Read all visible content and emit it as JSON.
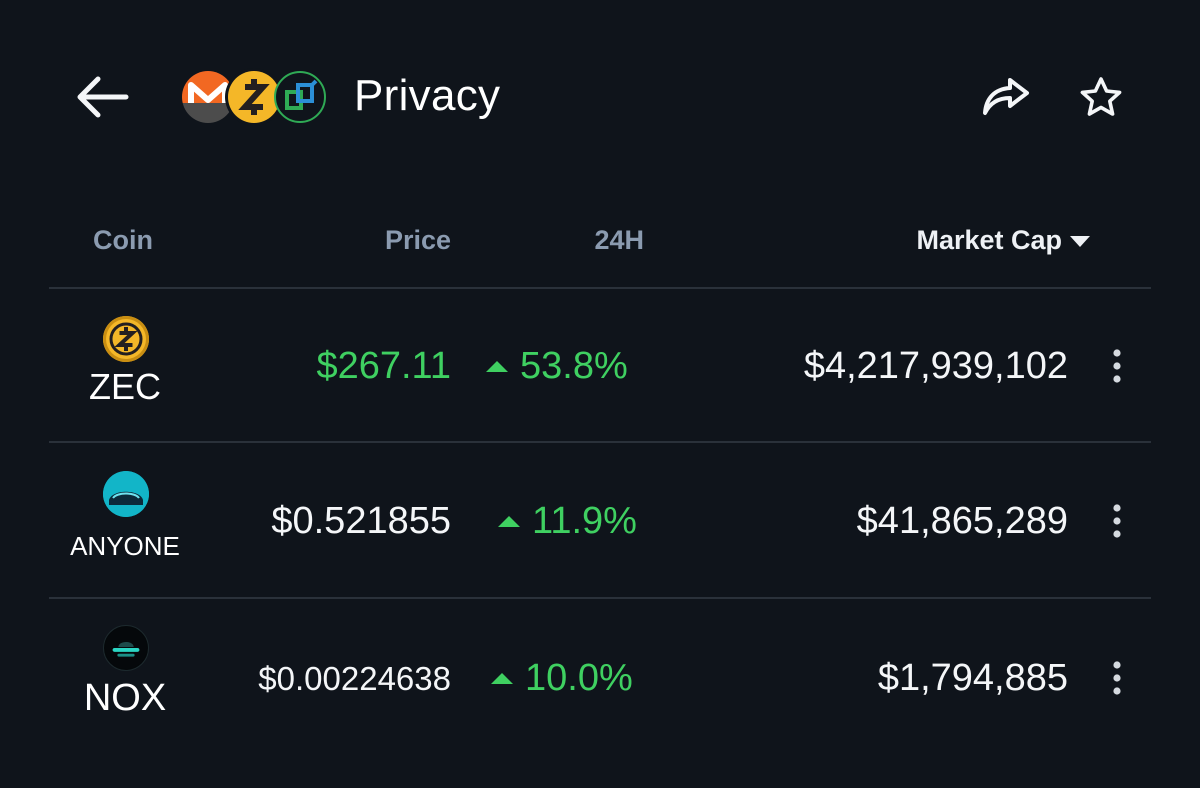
{
  "header": {
    "title": "Privacy",
    "back_icon": "arrow-left-icon",
    "share_icon": "share-icon",
    "favorite_icon": "star-icon",
    "category_logos": [
      "monero-logo",
      "zcash-logo",
      "category-coin-logo"
    ]
  },
  "table": {
    "columns": {
      "coin": "Coin",
      "price": "Price",
      "change": "24H",
      "market_cap": "Market Cap"
    },
    "sort": {
      "column": "market_cap",
      "direction": "descending"
    },
    "rows": [
      {
        "symbol": "ZEC",
        "price": "$267.11",
        "change": "53.8%",
        "direction": "up",
        "market_cap": "$4,217,939,102",
        "price_color": "#3fd061"
      },
      {
        "symbol": "ANYONE",
        "price": "$0.521855",
        "change": "11.9%",
        "direction": "up",
        "market_cap": "$41,865,289",
        "price_color": "#f4f6f8"
      },
      {
        "symbol": "NOX",
        "price": "$0.00224638",
        "change": "10.0%",
        "direction": "up",
        "market_cap": "$1,794,885",
        "price_color": "#f4f6f8"
      }
    ]
  },
  "colors": {
    "background": "#0f141b",
    "positive": "#3fd061",
    "muted_header": "#8b9bb0",
    "divider": "#2a313a"
  }
}
